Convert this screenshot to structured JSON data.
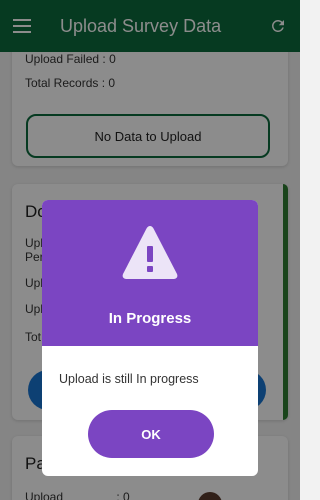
{
  "appbar": {
    "title": "Upload Survey Data",
    "menu_icon": "hamburger-menu-icon",
    "refresh_icon": "refresh-icon",
    "background_color": "#0b6a3c"
  },
  "card1": {
    "upload_failed_label": "Upload Failed",
    "upload_failed_value": "0",
    "total_records_label": "Total Records",
    "total_records_value": "0",
    "no_data_button": "No Data to Upload"
  },
  "card2": {
    "heading": "Do",
    "line1": "Upl",
    "line2": "Per",
    "line3": "Upl",
    "line4": "Upl",
    "line5": "Tot"
  },
  "card3": {
    "heading": "Pa",
    "upload_label": "Upload",
    "upload_value": "0"
  },
  "dialog": {
    "icon": "warning-triangle-icon",
    "title": "In Progress",
    "message": "Upload is still In progress",
    "ok_label": "OK",
    "accent_color": "#7b45c2"
  }
}
